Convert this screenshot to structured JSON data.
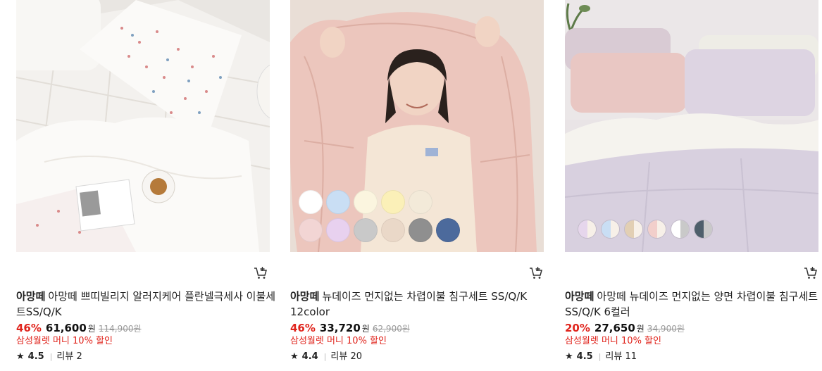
{
  "products": [
    {
      "brand": "아망떼",
      "title": "아망떼 쁘띠빌리지 알러지케어 플란넬극세사 이불세트SS/Q/K",
      "discount": "46%",
      "price": "61,600",
      "currency": "원",
      "original_price": "114,900",
      "original_currency": "원",
      "benefit": "삼성월렛 머니 10% 할인",
      "star": "★",
      "rating": "4.5",
      "review": "리뷰 2",
      "cart_icon": "cart-plus-icon"
    },
    {
      "brand": "아망떼",
      "title": "뉴데이즈 먼지없는 차렵이불 침구세트 SS/Q/K 12color",
      "discount": "46%",
      "price": "33,720",
      "currency": "원",
      "original_price": "62,900",
      "original_currency": "원",
      "benefit": "삼성월렛 머니 10% 할인",
      "star": "★",
      "rating": "4.4",
      "review": "리뷰 20",
      "cart_icon": "cart-plus-icon",
      "swatches": [
        "#ffffff",
        "#c9def4",
        "#fbf5df",
        "#fbf0b8",
        "#f3ead9",
        "#f2d5d4",
        "#e8d1ef",
        "#c9c9c9",
        "#ead8c8",
        "#8f8f8f",
        "#4c6a9c"
      ]
    },
    {
      "brand": "아망떼",
      "title": "아망떼 뉴데이즈 먼지없는 양면 차렵이불 침구세트 SS/Q/K 6컬러",
      "discount": "20%",
      "price": "27,650",
      "currency": "원",
      "original_price": "34,900",
      "original_currency": "원",
      "benefit": "삼성월렛 머니 10% 할인",
      "star": "★",
      "rating": "4.5",
      "review": "리뷰 11",
      "cart_icon": "cart-plus-icon",
      "split_swatches": [
        [
          "#e6d6ec",
          "#f7f0e8"
        ],
        [
          "#c9def4",
          "#f7f0e8"
        ],
        [
          "#e2cfb4",
          "#f7f0e8"
        ],
        [
          "#f2cfcb",
          "#f7f0e8"
        ],
        [
          "#ffffff",
          "#c9c9c9"
        ],
        [
          "#4e5f6b",
          "#c9c9c9"
        ]
      ]
    }
  ]
}
